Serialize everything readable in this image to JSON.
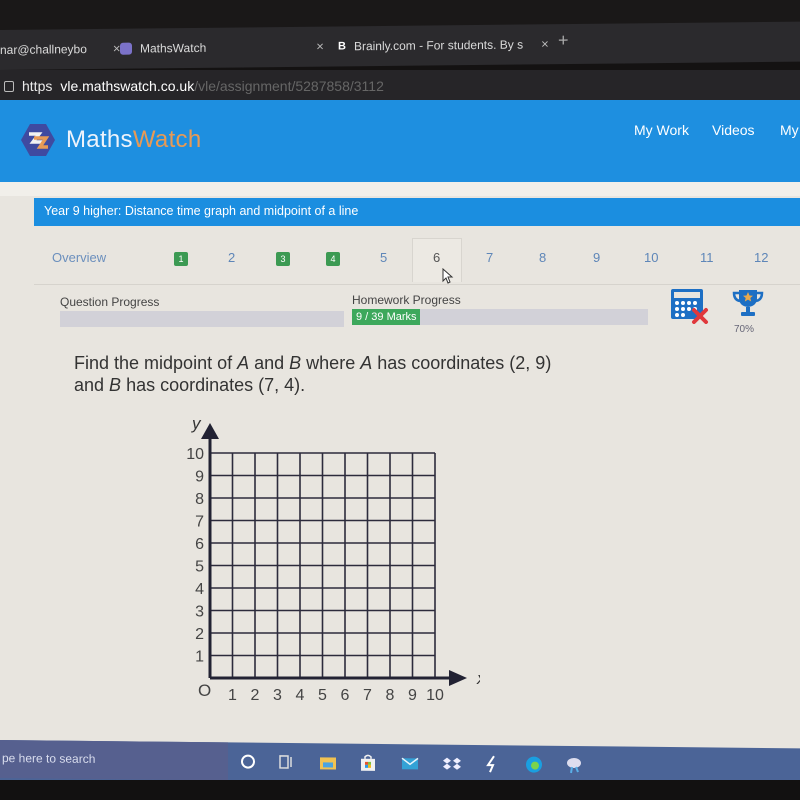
{
  "browser": {
    "tabs": [
      {
        "label": "nar@challneybo",
        "close": "×"
      },
      {
        "label": "MathsWatch",
        "close": "×",
        "icon": "mathswatch-favicon"
      },
      {
        "label": "Brainly.com - For students. By s",
        "close": "×",
        "icon": "brainly-favicon",
        "icon_glyph": "B"
      }
    ],
    "new_tab": "+",
    "address": {
      "protocol": "https",
      "host": "vle.mathswatch.co.uk",
      "path": "/vle/assignment/5287858/3112"
    }
  },
  "header": {
    "brand_prefix": "Maths",
    "brand_suffix": "Watch",
    "nav": [
      "My Work",
      "Videos",
      "My"
    ],
    "colors": {
      "bar": "#1e8fe0",
      "brand_accent": "#e79a55"
    }
  },
  "assignment": {
    "title": "Year 9 higher: Distance time graph and midpoint of a line"
  },
  "question_tabs": {
    "overview": "Overview",
    "items": [
      {
        "label": "1",
        "status": "complete"
      },
      {
        "label": "2",
        "status": "incomplete"
      },
      {
        "label": "3",
        "status": "complete"
      },
      {
        "label": "4",
        "status": "complete"
      },
      {
        "label": "5",
        "status": "incomplete"
      },
      {
        "label": "6",
        "status": "active"
      },
      {
        "label": "7",
        "status": "incomplete"
      },
      {
        "label": "8",
        "status": "incomplete"
      },
      {
        "label": "9",
        "status": "incomplete"
      },
      {
        "label": "10",
        "status": "incomplete"
      },
      {
        "label": "11",
        "status": "incomplete"
      },
      {
        "label": "12",
        "status": "incomplete"
      }
    ]
  },
  "progress": {
    "question_label": "Question Progress",
    "question_fraction": 0,
    "homework_label": "Homework Progress",
    "homework_text": "9 / 39 Marks",
    "homework_marks": 9,
    "homework_total": 39,
    "calculator": "calculator-not-allowed-icon",
    "trophy_percent": "70%",
    "colors": {
      "fill": "#3da85c",
      "track": "#d2d1d8"
    }
  },
  "question": {
    "line1_pre": "Find the midpoint of ",
    "A": "A",
    "and": " and ",
    "B": "B",
    "line1_post": " where ",
    "A2": "A",
    "line1_end": " has coordinates (2, 9)",
    "line2_pre": "and ",
    "B2": "B",
    "line2_post": " has coordinates (7, 4)."
  },
  "graph": {
    "x_label": "x",
    "y_label": "y",
    "origin_label": "O",
    "x_ticks": [
      "1",
      "2",
      "3",
      "4",
      "5",
      "6",
      "7",
      "8",
      "9",
      "10"
    ],
    "y_ticks": [
      "1",
      "2",
      "3",
      "4",
      "5",
      "6",
      "7",
      "8",
      "9",
      "10"
    ],
    "x_range": [
      0,
      10
    ],
    "y_range": [
      0,
      10
    ]
  },
  "taskbar": {
    "search_placeholder": "pe here to search",
    "icons": [
      "cortana-icon",
      "task-view-icon",
      "file-explorer-icon",
      "store-icon",
      "mail-icon",
      "dropbox-icon",
      "app-bolt-icon",
      "edge-icon",
      "app-cloud-icon"
    ]
  }
}
